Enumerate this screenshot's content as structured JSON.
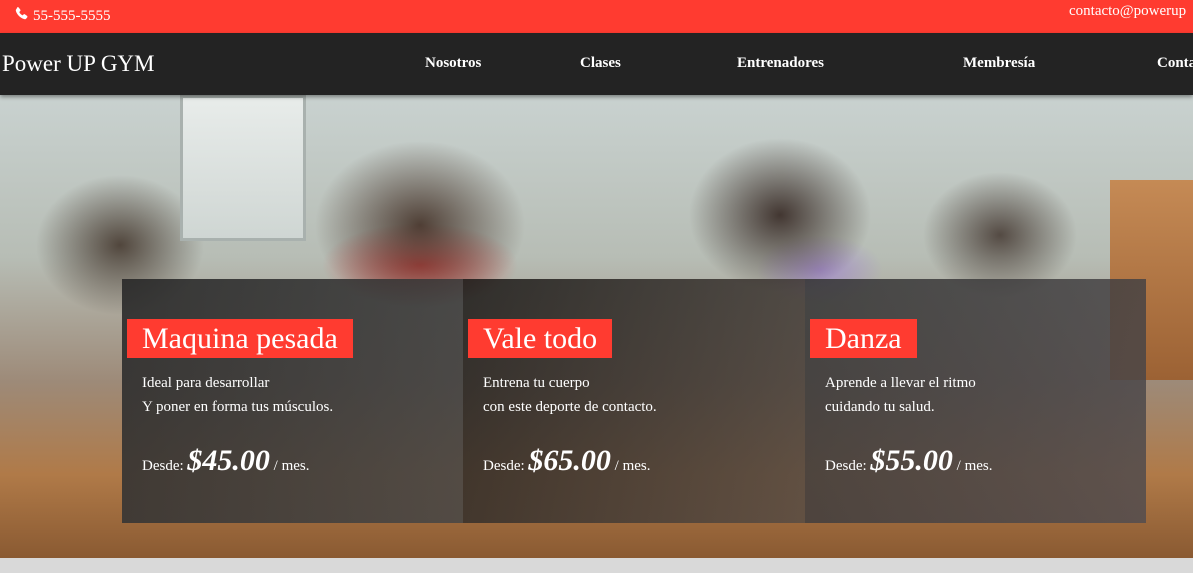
{
  "topbar": {
    "phone": "55-555-5555",
    "email": "contacto@powerup"
  },
  "navbar": {
    "brand": "Power UP GYM",
    "items": [
      {
        "label": "Nosotros"
      },
      {
        "label": "Clases"
      },
      {
        "label": "Entrenadores"
      },
      {
        "label": "Membresía"
      },
      {
        "label": "Conta"
      }
    ]
  },
  "cards": [
    {
      "title": "Maquina pesada",
      "desc_line1": "Ideal para desarrollar",
      "desc_line2": "Y poner en forma tus músculos.",
      "price_prefix": "Desde:",
      "price": "$45.00",
      "price_suffix": "/ mes."
    },
    {
      "title": "Vale todo",
      "desc_line1": "Entrena tu cuerpo",
      "desc_line2": "con este deporte de contacto.",
      "price_prefix": "Desde:",
      "price": "$65.00",
      "price_suffix": "/ mes."
    },
    {
      "title": "Danza",
      "desc_line1": "Aprende a llevar el ritmo",
      "desc_line2": "cuidando tu salud.",
      "price_prefix": "Desde:",
      "price": "$55.00",
      "price_suffix": "/ mes."
    }
  ],
  "colors": {
    "accent": "#ff3b30",
    "navbar": "#232323"
  },
  "icons": {
    "phone": "phone-icon"
  }
}
